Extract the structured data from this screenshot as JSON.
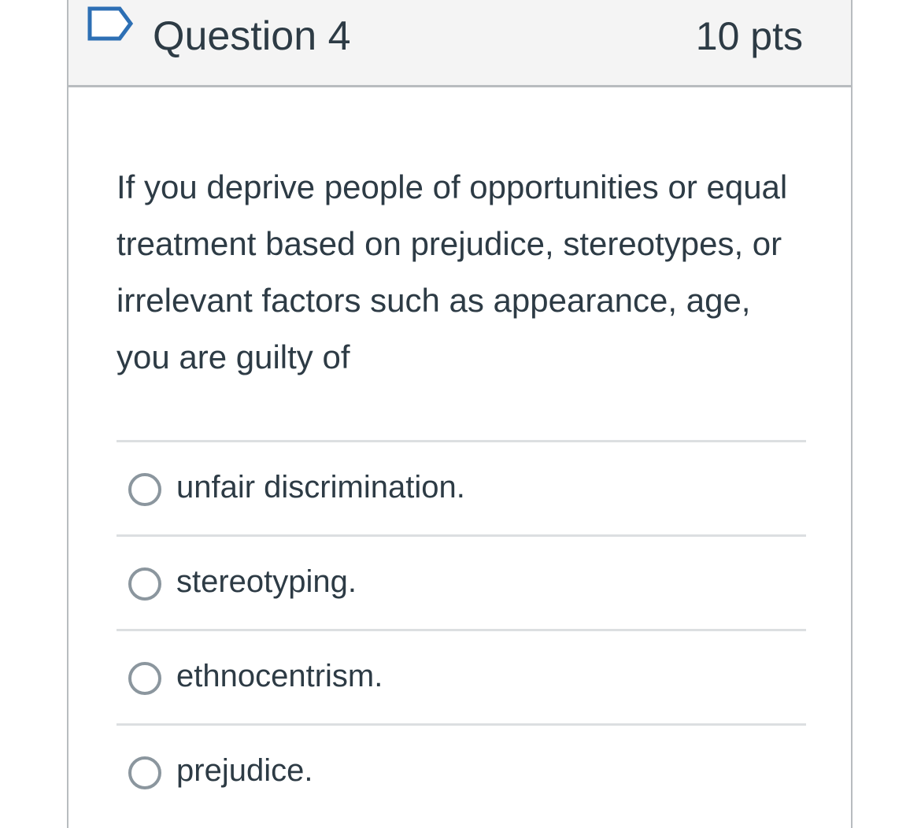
{
  "question": {
    "title": "Question 4",
    "points": "10 pts",
    "flag_icon": "flag-outline-icon",
    "text": "If you deprive people of opportunities or equal treatment based on prejudice, stereotypes, or irrelevant factors such as appearance, age, you are guilty of"
  },
  "answers": [
    {
      "label": "unfair discrimination."
    },
    {
      "label": "stereotyping."
    },
    {
      "label": "ethnocentrism."
    },
    {
      "label": "prejudice."
    }
  ],
  "colors": {
    "text": "#2d3b45",
    "header_bg": "#f4f4f4",
    "border": "#b8bcbf",
    "divider": "#dcdfe1",
    "radio_border": "#8b969e",
    "flag_stroke": "#2d6fb4"
  }
}
